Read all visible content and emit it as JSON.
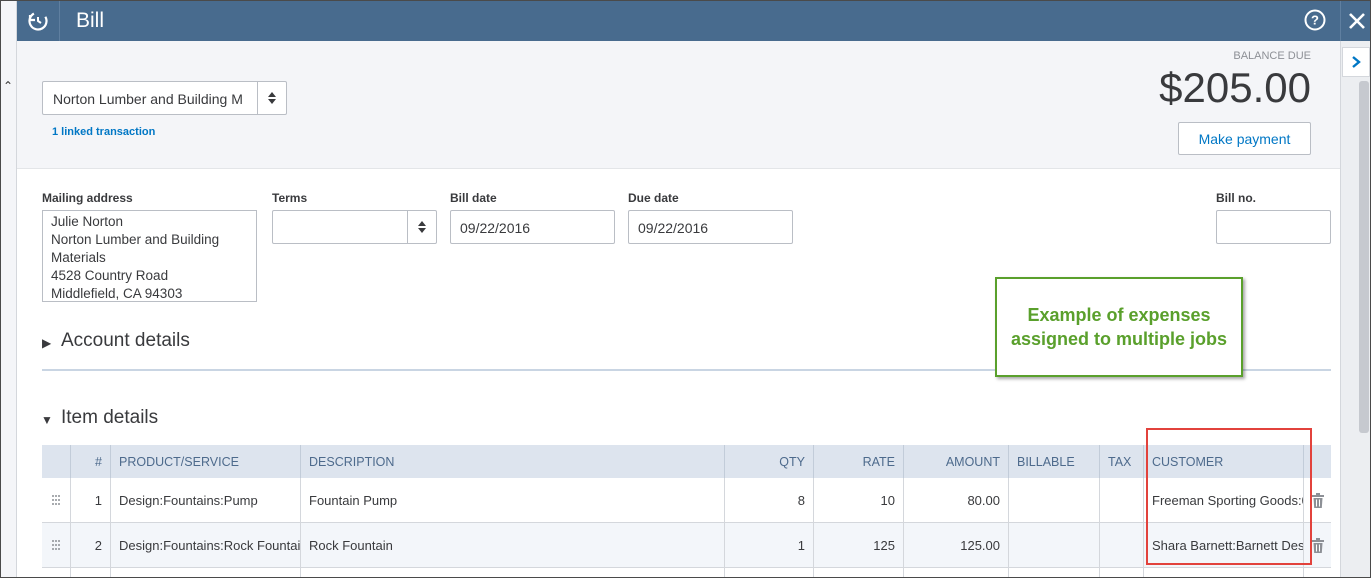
{
  "header": {
    "title": "Bill",
    "colors": {
      "header_bg": "#486b8e",
      "accent": "#0077c5",
      "callout_green": "#5aa02c",
      "highlight_red": "#e2423c"
    }
  },
  "vendor": {
    "name": "Norton Lumber and Building M",
    "linked_transactions": "1 linked transaction"
  },
  "balance": {
    "label": "BALANCE DUE",
    "amount": "$205.00",
    "make_payment_label": "Make payment"
  },
  "form": {
    "mailing_address_label": "Mailing address",
    "mailing_address_lines": [
      "Julie Norton",
      "Norton Lumber and Building",
      "Materials",
      "4528 Country Road",
      "Middlefield, CA  94303"
    ],
    "terms_label": "Terms",
    "terms_value": "",
    "bill_date_label": "Bill date",
    "bill_date_value": "09/22/2016",
    "due_date_label": "Due date",
    "due_date_value": "09/22/2016",
    "bill_no_label": "Bill no.",
    "bill_no_value": ""
  },
  "callout": {
    "text": "Example of expenses assigned to multiple jobs"
  },
  "sections": {
    "account_details": "Account details",
    "item_details": "Item details"
  },
  "items_table": {
    "columns": [
      "",
      "#",
      "PRODUCT/SERVICE",
      "DESCRIPTION",
      "QTY",
      "RATE",
      "AMOUNT",
      "BILLABLE",
      "TAX",
      "CUSTOMER",
      ""
    ],
    "rows": [
      {
        "num": "1",
        "product": "Design:Fountains:Pump",
        "description": "Fountain Pump",
        "qty": "8",
        "rate": "10",
        "amount": "80.00",
        "billable": "",
        "tax": "",
        "customer": "Freeman Sporting Goods:0"
      },
      {
        "num": "2",
        "product": "Design:Fountains:Rock Fountai",
        "description": "Rock Fountain",
        "qty": "1",
        "rate": "125",
        "amount": "125.00",
        "billable": "",
        "tax": "",
        "customer": "Shara Barnett:Barnett Des"
      }
    ]
  },
  "icons": {
    "app": "quickbooks-history-icon",
    "help": "help-icon",
    "close": "close-icon",
    "drawer": "chevron-right-icon",
    "drag": "drag-handle-icon",
    "delete": "trash-icon",
    "select": "up-down-arrows-icon"
  }
}
